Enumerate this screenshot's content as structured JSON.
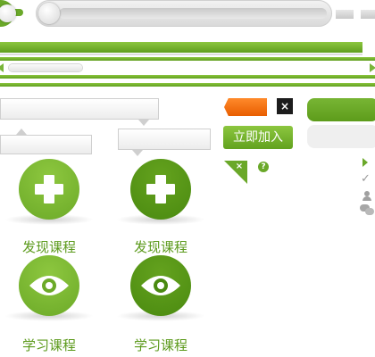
{
  "slider": {
    "value": 0
  },
  "courses": [
    {
      "label": "发现课程",
      "icon": "plus-icon",
      "variant": "light"
    },
    {
      "label": "发现课程",
      "icon": "plus-icon",
      "variant": "dark"
    },
    {
      "label": "学习课程",
      "icon": "eye-icon",
      "variant": "light"
    },
    {
      "label": "学习课程",
      "icon": "eye-icon",
      "variant": "dark"
    }
  ],
  "join_button": {
    "label": "立即加入"
  },
  "close_glyph": "×",
  "help_glyph": "?",
  "check_glyph": "✓",
  "icons": [
    "close-icon",
    "help-icon",
    "play-icon",
    "check-icon",
    "user-icon",
    "chat-icon",
    "arrow-left-icon",
    "arrow-right-icon"
  ],
  "colors": {
    "brand_green": "#6aa829",
    "dark_green": "#4a8a10",
    "orange": "#f07a10",
    "text_green": "#5c9a1c"
  }
}
